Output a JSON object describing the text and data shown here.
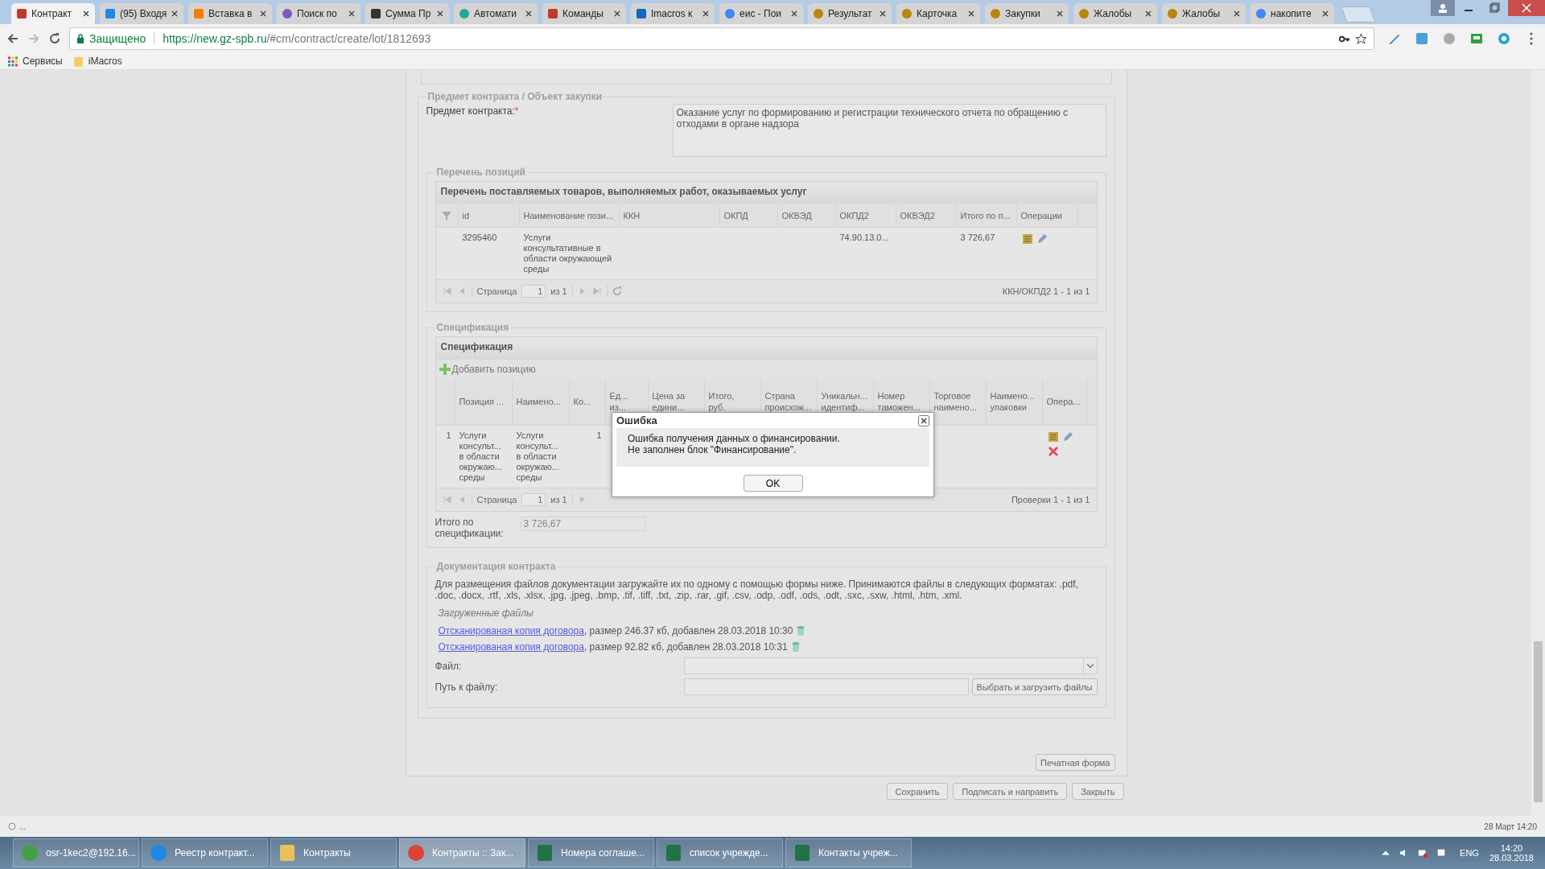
{
  "browser": {
    "tabs": [
      {
        "title": "Контракт",
        "kind": "tool",
        "selected": true
      },
      {
        "title": "(95) Входя",
        "kind": "mail",
        "selected": false
      },
      {
        "title": "Вставка в",
        "kind": "orange",
        "selected": false
      },
      {
        "title": "Поиск по",
        "kind": "person",
        "selected": false
      },
      {
        "title": "Сумма Пр",
        "kind": "sigma",
        "selected": false
      },
      {
        "title": "Автомати",
        "kind": "teal",
        "selected": false
      },
      {
        "title": "Команды",
        "kind": "tool",
        "selected": false
      },
      {
        "title": "Imacros к",
        "kind": "monitor",
        "selected": false
      },
      {
        "title": "еис - Пои",
        "kind": "google",
        "selected": false
      },
      {
        "title": "Результат",
        "kind": "emblem",
        "selected": false
      },
      {
        "title": "Карточка",
        "kind": "emblem",
        "selected": false
      },
      {
        "title": "Закупки",
        "kind": "emblem",
        "selected": false
      },
      {
        "title": "Жалобы",
        "kind": "emblem",
        "selected": false
      },
      {
        "title": "Жалобы",
        "kind": "emblem",
        "selected": false
      },
      {
        "title": "накопите",
        "kind": "google",
        "selected": false
      }
    ],
    "secure_label": "Защищено",
    "url_host": "https://new.gz-spb.ru",
    "url_path": "/#cm/contract/create/lot/1812693",
    "bookmarks": [
      {
        "label": "Сервисы",
        "kind": "apps"
      },
      {
        "label": "iMacros",
        "kind": "folder"
      }
    ]
  },
  "subject": {
    "legend": "Предмет контракта / Объект закупки",
    "label": "Предмет контракта:",
    "required_mark": "*",
    "value": "Оказание услуг по формированию и регистрации технического отчета по обращению с отходами в органе надзора"
  },
  "positions": {
    "legend": "Перечень позиций",
    "title": "Перечень поставляемых товаров, выполняемых работ, оказываемых услуг",
    "columns": [
      "id",
      "Наименование пози...",
      "ККН",
      "ОКПД",
      "ОКВЭД",
      "ОКПД2",
      "ОКВЭД2",
      "Итого по п...",
      "Операции"
    ],
    "rows": [
      {
        "cells": [
          "3295460",
          "Услуги консультативные в области окружающей среды",
          "",
          "",
          "",
          "74.90.13.0...",
          "",
          "3 726,67"
        ]
      }
    ],
    "pager": {
      "page_label": "Страница",
      "page": "1",
      "of": "из 1",
      "summary": "ККН/ОКПД2 1 - 1 из 1"
    }
  },
  "specification": {
    "legend": "Спецификация",
    "title": "Спецификация",
    "add_label": "Добавить позицию",
    "columns": [
      "",
      "Позиция ...",
      "Наимено...",
      "Ко...",
      "Ед...\nиз...",
      "Цена за\nедини...",
      "Итого,\nруб.",
      "Страна\nпроисхож...",
      "Уникальн...\nидентиф...",
      "Номер\nтаможен...",
      "Торговое\nнаимено...",
      "Наимено...\nупаковки",
      "Опера..."
    ],
    "rows": [
      {
        "cells": [
          "1",
          "Услуги\nконсульт...\nв области\nокружаю...\nсреды",
          "Услуги\nконсульт...\nв области\nокружаю...\nсреды",
          "1"
        ]
      }
    ],
    "pager": {
      "page_label": "Страница",
      "page": "1",
      "of": "из 1",
      "summary": "Проверки 1 - 1 из 1"
    },
    "total_label": "Итого по\nспецификации:",
    "total_value": "3 726,67"
  },
  "documents": {
    "legend": "Документация контракта",
    "hint": "Для размещения файлов документации загружайте их по одному с помощью формы ниже. Принимаются файлы в следующих форматах: .pdf, .doc, .docx, .rtf, .xls, .xlsx, .jpg, .jpeg, .bmp, .tif, .tiff, .txt, .zip, .rar, .gif, .csv, .odp, .odf, .ods, .odt, .sxc, .sxw, .html, .htm, .xml.",
    "uploaded_label": "Загруженные файлы",
    "files": [
      {
        "name": "Отсканированая копия договора",
        "info": ", размер 246.37 кб, добавлен 28.03.2018 10:30"
      },
      {
        "name": "Отсканированая копия договора",
        "info": ", размер 92.82 кб, добавлен 28.03.2018 10:31"
      }
    ],
    "file_label": "Файл:",
    "path_label": "Путь к файлу:",
    "upload_button": "Выбрать и загрузить файлы"
  },
  "print_button": "Печатная форма",
  "buttons": [
    "Сохранить",
    "Подписать и направить",
    "Закрыть"
  ],
  "dialog": {
    "title": "Ошибка",
    "lines": [
      "Ошибка получения данных о финансировании.",
      "Не заполнен блок \"Финансирование\"."
    ],
    "button": "OK"
  },
  "status": {
    "left": "...",
    "right": "28 Март 14:20"
  },
  "taskbar": {
    "items": [
      {
        "label": "osr-1kec2@192.16...",
        "kind": "chat",
        "selected": false
      },
      {
        "label": "Реестр контракт...",
        "kind": "ie",
        "selected": false
      },
      {
        "label": "Контракты",
        "kind": "folder",
        "selected": false
      },
      {
        "label": "Контракты :: Зак...",
        "kind": "chrome",
        "selected": true
      },
      {
        "label": "Номера соглаше...",
        "kind": "excel",
        "selected": false
      },
      {
        "label": "список учрежде...",
        "kind": "excel",
        "selected": false
      },
      {
        "label": "Контакты учреж...",
        "kind": "excel",
        "selected": false
      }
    ],
    "lang": "ENG",
    "time": "14:20",
    "date": "28.03.2018"
  }
}
